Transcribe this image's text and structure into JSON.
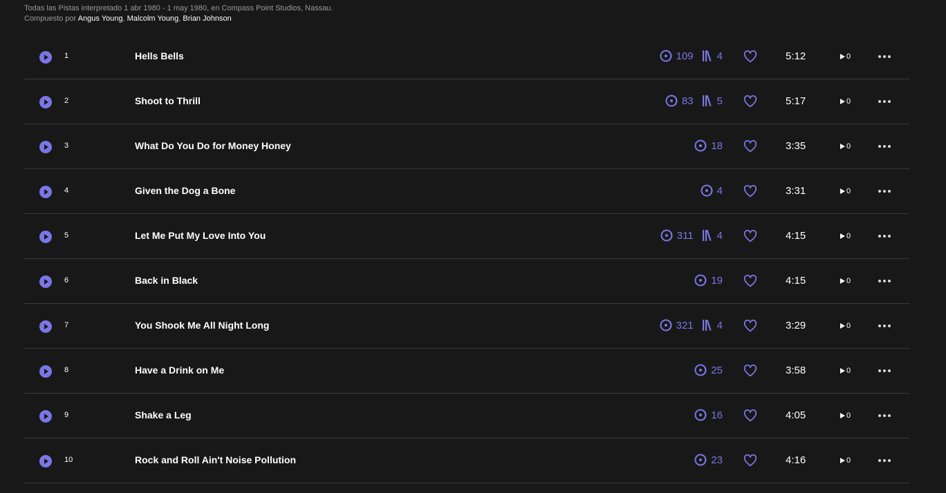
{
  "credits": {
    "line1": "Todas las Pistas interpretado 1 abr 1980 - 1 may 1980, en Compass Point Studios, Nassau.",
    "composed_prefix": "Compuesto por ",
    "composers": [
      "Angus Young",
      "Malcolm Young",
      "Brian Johnson"
    ]
  },
  "colors": {
    "background": "#181818",
    "accent": "#7b76e6",
    "divider": "#3a3a3a"
  },
  "tracks": [
    {
      "num": "1",
      "title": "Hells Bells",
      "listens": "109",
      "lists": "4",
      "duration": "5:12",
      "plays": "0"
    },
    {
      "num": "2",
      "title": "Shoot to Thrill",
      "listens": "83",
      "lists": "5",
      "duration": "5:17",
      "plays": "0"
    },
    {
      "num": "3",
      "title": "What Do You Do for Money Honey",
      "listens": "18",
      "lists": "",
      "duration": "3:35",
      "plays": "0"
    },
    {
      "num": "4",
      "title": "Given the Dog a Bone",
      "listens": "4",
      "lists": "",
      "duration": "3:31",
      "plays": "0"
    },
    {
      "num": "5",
      "title": "Let Me Put My Love Into You",
      "listens": "311",
      "lists": "4",
      "duration": "4:15",
      "plays": "0"
    },
    {
      "num": "6",
      "title": "Back in Black",
      "listens": "19",
      "lists": "",
      "duration": "4:15",
      "plays": "0"
    },
    {
      "num": "7",
      "title": "You Shook Me All Night Long",
      "listens": "321",
      "lists": "4",
      "duration": "3:29",
      "plays": "0"
    },
    {
      "num": "8",
      "title": "Have a Drink on Me",
      "listens": "25",
      "lists": "",
      "duration": "3:58",
      "plays": "0"
    },
    {
      "num": "9",
      "title": "Shake a Leg",
      "listens": "16",
      "lists": "",
      "duration": "4:05",
      "plays": "0"
    },
    {
      "num": "10",
      "title": "Rock and Roll Ain't Noise Pollution",
      "listens": "23",
      "lists": "",
      "duration": "4:16",
      "plays": "0"
    }
  ]
}
